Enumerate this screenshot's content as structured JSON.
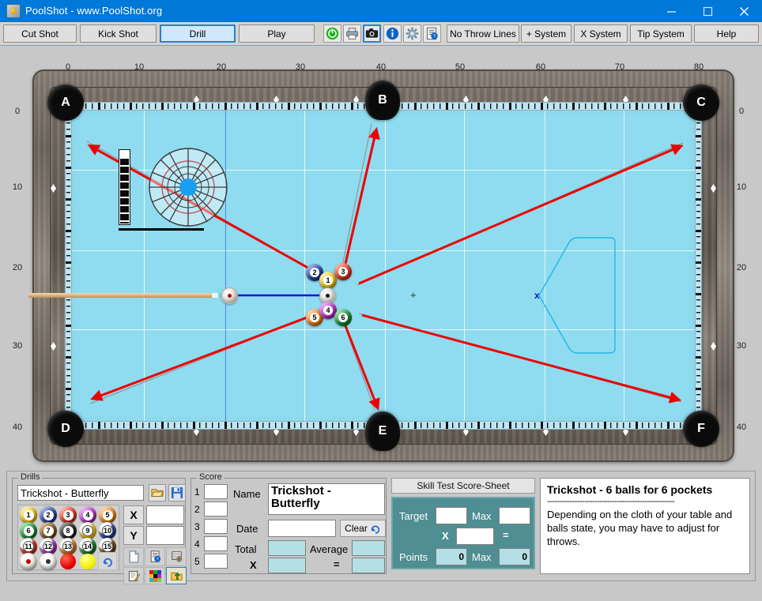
{
  "window": {
    "title": "PoolShot - www.PoolShot.org",
    "minimize": "–",
    "maximize": "☐",
    "close": "✕"
  },
  "toolbar": {
    "mode_tabs": [
      {
        "label": "Cut Shot",
        "selected": false
      },
      {
        "label": "Kick Shot",
        "selected": false
      },
      {
        "label": "Drill",
        "selected": true
      },
      {
        "label": "Play",
        "selected": false
      }
    ],
    "icon_buttons": [
      {
        "name": "power-icon",
        "selected": false
      },
      {
        "name": "printer-icon",
        "selected": false
      },
      {
        "name": "camera-icon",
        "selected": true
      },
      {
        "name": "info-icon",
        "selected": false
      },
      {
        "name": "gear-icon",
        "selected": false
      },
      {
        "name": "help-document-icon",
        "selected": false
      }
    ],
    "system_buttons": [
      {
        "label": "No Throw Lines"
      },
      {
        "label": "+ System"
      },
      {
        "label": "X System"
      },
      {
        "label": "Tip System"
      },
      {
        "label": "Help"
      }
    ]
  },
  "table": {
    "x_ticks": [
      "0",
      "10",
      "20",
      "30",
      "40",
      "50",
      "60",
      "70",
      "80"
    ],
    "y_ticks": [
      "0",
      "10",
      "20",
      "30",
      "40"
    ],
    "pockets": [
      {
        "label": "A"
      },
      {
        "label": "B"
      },
      {
        "label": "C"
      },
      {
        "label": "D"
      },
      {
        "label": "E"
      },
      {
        "label": "F"
      }
    ],
    "balls": [
      {
        "number": "2",
        "color": "#1f3f9e",
        "type": "solid"
      },
      {
        "number": "1",
        "color": "#f2c40e",
        "type": "solid"
      },
      {
        "number": "3",
        "color": "#e03018",
        "type": "solid"
      },
      {
        "number": "5",
        "color": "#f07d12",
        "type": "solid"
      },
      {
        "number": "4",
        "color": "#b32fc4",
        "type": "solid"
      },
      {
        "number": "6",
        "color": "#0f8a2a",
        "type": "solid"
      }
    ],
    "cue_ball": {
      "name": "cue-ball",
      "spot_color": "#c20000"
    },
    "rack_marker": "x",
    "aim_line_color": "#1616d8",
    "shot_line_color": "#ee0000",
    "ghost_line_color": "#8d8d8d"
  },
  "drills": {
    "group_label": "Drills",
    "selected_drill": "Trickshot - Butterfly",
    "open_icon": "open-folder-icon",
    "save_icon": "save-disk-icon",
    "ball_palette": [
      {
        "number": "1",
        "color": "#f2c40e",
        "type": "solid"
      },
      {
        "number": "2",
        "color": "#1f3f9e",
        "type": "solid"
      },
      {
        "number": "3",
        "color": "#e03018",
        "type": "solid"
      },
      {
        "number": "4",
        "color": "#b32fc4",
        "type": "solid"
      },
      {
        "number": "5",
        "color": "#f07d12",
        "type": "solid"
      },
      {
        "number": "6",
        "color": "#0f8a2a",
        "type": "solid"
      },
      {
        "number": "7",
        "color": "#7a4b16",
        "type": "solid"
      },
      {
        "number": "8",
        "color": "#1a1a1a",
        "type": "solid"
      },
      {
        "number": "9",
        "color": "#f2c40e",
        "type": "stripe"
      },
      {
        "number": "10",
        "color": "#1f3f9e",
        "type": "stripe"
      },
      {
        "number": "11",
        "color": "#e03018",
        "type": "stripe"
      },
      {
        "number": "12",
        "color": "#b32fc4",
        "type": "stripe"
      },
      {
        "number": "13",
        "color": "#f07d12",
        "type": "stripe"
      },
      {
        "number": "14",
        "color": "#0f8a2a",
        "type": "stripe"
      },
      {
        "number": "15",
        "color": "#7a4b16",
        "type": "stripe"
      }
    ],
    "extra_palette": [
      {
        "name": "cue-ball-red-spot",
        "color": "#f5efe2",
        "spot": "#c20000"
      },
      {
        "name": "cue-ball-black-spot",
        "color": "#f2f2f2",
        "spot": "#333333"
      },
      {
        "name": "red-object-ball",
        "color": "#ee0000",
        "spot": ""
      },
      {
        "name": "yellow-object-ball",
        "color": "#f4f400",
        "spot": ""
      },
      {
        "name": "undo-arrow-icon",
        "color": "",
        "spot": ""
      }
    ],
    "axis_buttons": [
      {
        "label": "X",
        "value": ""
      },
      {
        "label": "Y",
        "value": ""
      }
    ],
    "tool_icons": [
      {
        "name": "new-page-icon"
      },
      {
        "name": "page-help-icon"
      },
      {
        "name": "table-settings-icon"
      },
      {
        "name": "edit-notes-icon"
      },
      {
        "name": "color-palette-icon"
      },
      {
        "name": "export-folder-icon"
      }
    ]
  },
  "score": {
    "group_label": "Score",
    "rows": [
      {
        "index": "1",
        "value": ""
      },
      {
        "index": "2",
        "value": ""
      },
      {
        "index": "3",
        "value": ""
      },
      {
        "index": "4",
        "value": ""
      },
      {
        "index": "5",
        "value": ""
      }
    ],
    "name_label": "Name",
    "name_value": "Trickshot - Butterfly",
    "date_label": "Date",
    "date_value": "",
    "clear_label": "Clear",
    "clear_icon": "undo-arrow-icon",
    "total_label": "Total",
    "total_value": "",
    "average_label": "Average",
    "average_value": "",
    "times_label": "X",
    "times_value": "",
    "equals_label": "=",
    "equals_value": ""
  },
  "skill_test": {
    "header": "Skill Test Score-Sheet",
    "target_label": "Target",
    "target_value": "",
    "max1_label": "Max",
    "max1_value": "",
    "times_label": "X",
    "times_value": "",
    "equals_label": "=",
    "points_label": "Points",
    "points_value": "0",
    "max2_label": "Max",
    "max2_value": "0"
  },
  "description": {
    "title": "Trickshot - 6 balls for 6 pockets",
    "divider": "---------------------------------------------------",
    "body": "Depending on the cloth of your table and balls state, you may have to adjust for throws."
  }
}
